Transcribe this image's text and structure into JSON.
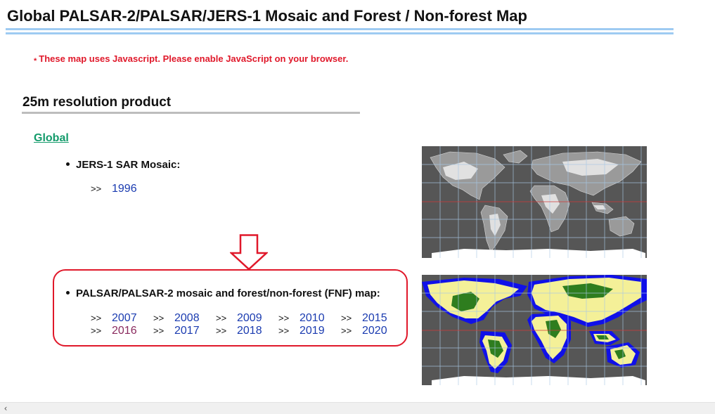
{
  "page_title": "Global PALSAR-2/PALSAR/JERS-1 Mosaic and Forest / Non-forest Map",
  "js_notice": {
    "star": "*",
    "text": "These map uses Javascript. Please enable JavaScript on your browser."
  },
  "section_title": "25m resolution product",
  "global_link": "Global",
  "jers": {
    "title": "JERS-1 SAR Mosaic:",
    "arrow": ">>",
    "years": [
      "1996"
    ]
  },
  "palsar": {
    "title": "PALSAR/PALSAR-2 mosaic and forest/non-forest (FNF) map:",
    "arrow": ">>",
    "row1": [
      "2007",
      "2008",
      "2009",
      "2010",
      "2015"
    ],
    "row2": [
      "2016",
      "2017",
      "2018",
      "2019",
      "2020"
    ],
    "visited_year": "2016"
  },
  "colors": {
    "accent_red": "#e0182a",
    "link_blue": "#1a3bb0",
    "link_visited": "#8a2a5e",
    "global_green": "#139b6b",
    "rule_blue": "#9ecbf2"
  },
  "icons": {
    "down_arrow": "down-arrow-icon",
    "scroll_left": "chevron-left-icon"
  },
  "scrollbar": {
    "left_glyph": "‹"
  }
}
